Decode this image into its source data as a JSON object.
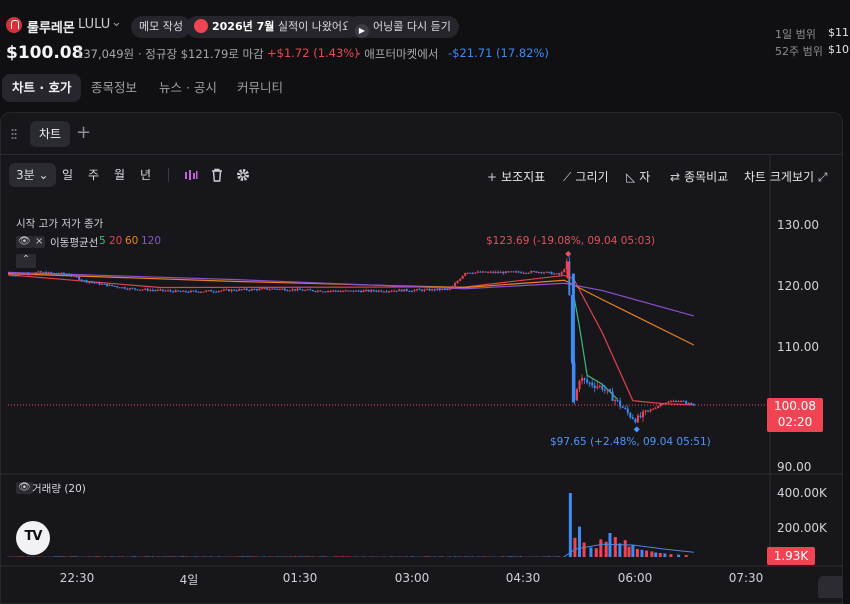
{
  "header": {
    "stock_name": "룰루레몬",
    "ticker": "LULU",
    "memo_label": "메모 작성",
    "earnings_pill": "2026년 7월 실적이 나왔어요",
    "earnings_bold": "2026년 7월",
    "earnings_rest": " 실적이 나왔어요",
    "call_pill": "어닝콜 다시 듣기",
    "price": "$100.08",
    "volume_won": "137,049원",
    "regular_close": "· 정규장 $121.79로 마감",
    "regular_change": "+$1.72 (1.43%)",
    "after_label": "· 애프터마켓에서",
    "after_change": "-$21.71 (17.82%)",
    "range_1d_label": "1일 범위",
    "range_1d_value": "$11",
    "range_52w_label": "52주 범위",
    "range_52w_value": "$10"
  },
  "tabs": [
    "차트 · 호가",
    "종목정보",
    "뉴스 · 공시",
    "커뮤니티"
  ],
  "chart_panel": {
    "tab_label": "차트",
    "timeframes": [
      "3분",
      "일",
      "주",
      "월",
      "년"
    ],
    "tools": {
      "indicators": "보조지표",
      "draw": "그리기",
      "ruler": "자",
      "compare": "종목비교",
      "fullscreen": "차트 크게보기"
    },
    "ohlc_label": "시작 고가 저가 종가",
    "ma_label": "이동평균선",
    "ma_periods": [
      "5",
      "20",
      "60",
      "120"
    ],
    "volume_label": "거래량 (20)",
    "high_annotation": "$123.69 (-19.08%, 09.04 05:03)",
    "low_annotation": "$97.65 (+2.48%, 09.04 05:51)",
    "last_price_tag": "100.08",
    "countdown": "02:20",
    "volume_tag": "1.93K"
  },
  "colors": {
    "up": "#f04452",
    "down": "#3e8bf7",
    "ma5": "#3dbb78",
    "ma20": "#e0434f",
    "ma60": "#e8821e",
    "ma120": "#8b4fcf"
  },
  "chart_data": {
    "type": "candlestick",
    "price_axis": {
      "ticks": [
        "130.00",
        "120.00",
        "110.00",
        "100.00",
        "90.00"
      ],
      "ylim": [
        90,
        130
      ]
    },
    "volume_axis": {
      "ticks": [
        "400.00K",
        "200.00K"
      ],
      "ylim": [
        0,
        400000
      ]
    },
    "time_ticks": [
      "22:30",
      "4일",
      "01:30",
      "03:00",
      "04:30",
      "06:00",
      "07:30"
    ],
    "price_path": [
      [
        0,
        121.5
      ],
      [
        0.04,
        122.0
      ],
      [
        0.08,
        121.7
      ],
      [
        0.1,
        120.6
      ],
      [
        0.13,
        119.9
      ],
      [
        0.16,
        119.3
      ],
      [
        0.2,
        119.0
      ],
      [
        0.23,
        118.8
      ],
      [
        0.26,
        118.9
      ],
      [
        0.3,
        119.1
      ],
      [
        0.35,
        119.3
      ],
      [
        0.4,
        119.0
      ],
      [
        0.45,
        118.9
      ],
      [
        0.5,
        119.0
      ],
      [
        0.55,
        119.1
      ],
      [
        0.58,
        119.2
      ],
      [
        0.6,
        122.0
      ],
      [
        0.65,
        122.0
      ],
      [
        0.7,
        122.1
      ],
      [
        0.725,
        121.6
      ],
      [
        0.735,
        123.69
      ],
      [
        0.742,
        100.0
      ],
      [
        0.75,
        104.5
      ],
      [
        0.76,
        103.8
      ],
      [
        0.78,
        103.0
      ],
      [
        0.8,
        100.5
      ],
      [
        0.815,
        98.5
      ],
      [
        0.825,
        97.65
      ],
      [
        0.84,
        99.0
      ],
      [
        0.86,
        100.5
      ],
      [
        0.88,
        100.8
      ],
      [
        0.9,
        100.08
      ]
    ],
    "ma_paths": {
      "ma5": [
        [
          0.742,
          118.5
        ],
        [
          0.75,
          113.0
        ],
        [
          0.76,
          105.0
        ],
        [
          0.78,
          103.5
        ],
        [
          0.8,
          101.0
        ]
      ],
      "ma20": [
        [
          0,
          121.6
        ],
        [
          0.2,
          119.5
        ],
        [
          0.6,
          119.6
        ],
        [
          0.73,
          121.5
        ],
        [
          0.742,
          121.0
        ],
        [
          0.78,
          112.0
        ],
        [
          0.82,
          100.8
        ],
        [
          0.86,
          100.3
        ],
        [
          0.9,
          100.1
        ]
      ],
      "ma60": [
        [
          0,
          121.8
        ],
        [
          0.3,
          120.5
        ],
        [
          0.6,
          119.5
        ],
        [
          0.73,
          120.7
        ],
        [
          0.78,
          117.5
        ],
        [
          0.9,
          110.0
        ]
      ],
      "ma120": [
        [
          0,
          122.0
        ],
        [
          0.3,
          120.8
        ],
        [
          0.6,
          119.3
        ],
        [
          0.73,
          120.2
        ],
        [
          0.78,
          119.0
        ],
        [
          0.9,
          114.8
        ]
      ]
    },
    "volume_bars": [
      [
        0.738,
        400000,
        "down"
      ],
      [
        0.75,
        190000,
        "down"
      ],
      [
        0.744,
        120000,
        "up"
      ],
      [
        0.756,
        90000,
        "up"
      ],
      [
        0.765,
        60000,
        "down"
      ],
      [
        0.772,
        55000,
        "up"
      ],
      [
        0.778,
        110000,
        "up"
      ],
      [
        0.785,
        95000,
        "up"
      ],
      [
        0.79,
        150000,
        "down"
      ],
      [
        0.797,
        125000,
        "up"
      ],
      [
        0.803,
        85000,
        "down"
      ],
      [
        0.81,
        105000,
        "up"
      ],
      [
        0.815,
        65000,
        "up"
      ],
      [
        0.82,
        75000,
        "down"
      ],
      [
        0.826,
        50000,
        "up"
      ],
      [
        0.832,
        45000,
        "down"
      ],
      [
        0.838,
        40000,
        "up"
      ],
      [
        0.845,
        35000,
        "up"
      ],
      [
        0.85,
        28000,
        "down"
      ],
      [
        0.856,
        25000,
        "up"
      ],
      [
        0.862,
        22000,
        "down"
      ],
      [
        0.87,
        18000,
        "up"
      ],
      [
        0.88,
        15000,
        "down"
      ],
      [
        0.89,
        12000,
        "up"
      ]
    ],
    "last_price": 100.08
  }
}
